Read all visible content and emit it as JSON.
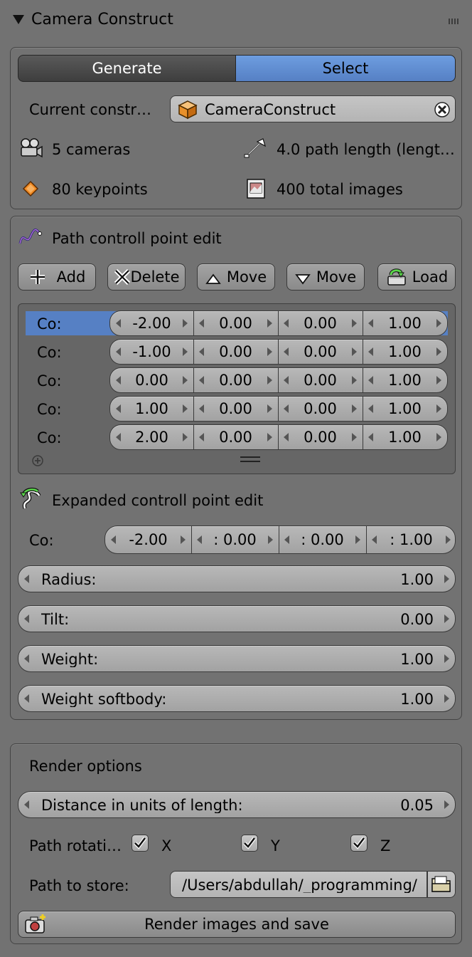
{
  "header": {
    "title": "Camera Construct"
  },
  "tabs": {
    "generate": "Generate",
    "select": "Select"
  },
  "construct": {
    "label": "Current constr…",
    "value": "CameraConstruct"
  },
  "stats": {
    "cameras": "5 cameras",
    "path_length": "4.0 path length (lengt…",
    "keypoints": "80 keypoints",
    "total_images": "400 total images"
  },
  "path_edit": {
    "title": "Path controll point edit",
    "buttons": {
      "add": "Add",
      "delete": "Delete",
      "move_up": "Move",
      "move_down": "Move",
      "load": "Load"
    },
    "rows": [
      {
        "label": "Co:",
        "values": [
          "-2.00",
          "0.00",
          "0.00",
          "1.00"
        ]
      },
      {
        "label": "Co:",
        "values": [
          "-1.00",
          "0.00",
          "0.00",
          "1.00"
        ]
      },
      {
        "label": "Co:",
        "values": [
          "0.00",
          "0.00",
          "0.00",
          "1.00"
        ]
      },
      {
        "label": "Co:",
        "values": [
          "1.00",
          "0.00",
          "0.00",
          "1.00"
        ]
      },
      {
        "label": "Co:",
        "values": [
          "2.00",
          "0.00",
          "0.00",
          "1.00"
        ]
      }
    ],
    "selected_row": 0
  },
  "expanded": {
    "title": "Expanded controll point edit",
    "co_label": "Co:",
    "co_values": [
      "-2.00",
      ": 0.00",
      ": 0.00",
      ": 1.00"
    ],
    "radius": {
      "label": "Radius:",
      "value": "1.00"
    },
    "tilt": {
      "label": "Tilt:",
      "value": "0.00"
    },
    "weight": {
      "label": "Weight:",
      "value": "1.00"
    },
    "weight_softbody": {
      "label": "Weight softbody:",
      "value": "1.00"
    }
  },
  "render": {
    "title": "Render options",
    "distance": {
      "label": "Distance in units of length:",
      "value": "0.05"
    },
    "rotation_label": "Path rotati…",
    "axes": [
      {
        "label": "X",
        "checked": true
      },
      {
        "label": "Y",
        "checked": true
      },
      {
        "label": "Z",
        "checked": true
      }
    ],
    "store_label": "Path to store:",
    "store_value": "/Users/abdullah/_programming/",
    "render_button": "Render images and save"
  },
  "colors": {
    "selected": "#5680c4",
    "panel": "#727272",
    "accent_orange": "#f08a24"
  }
}
